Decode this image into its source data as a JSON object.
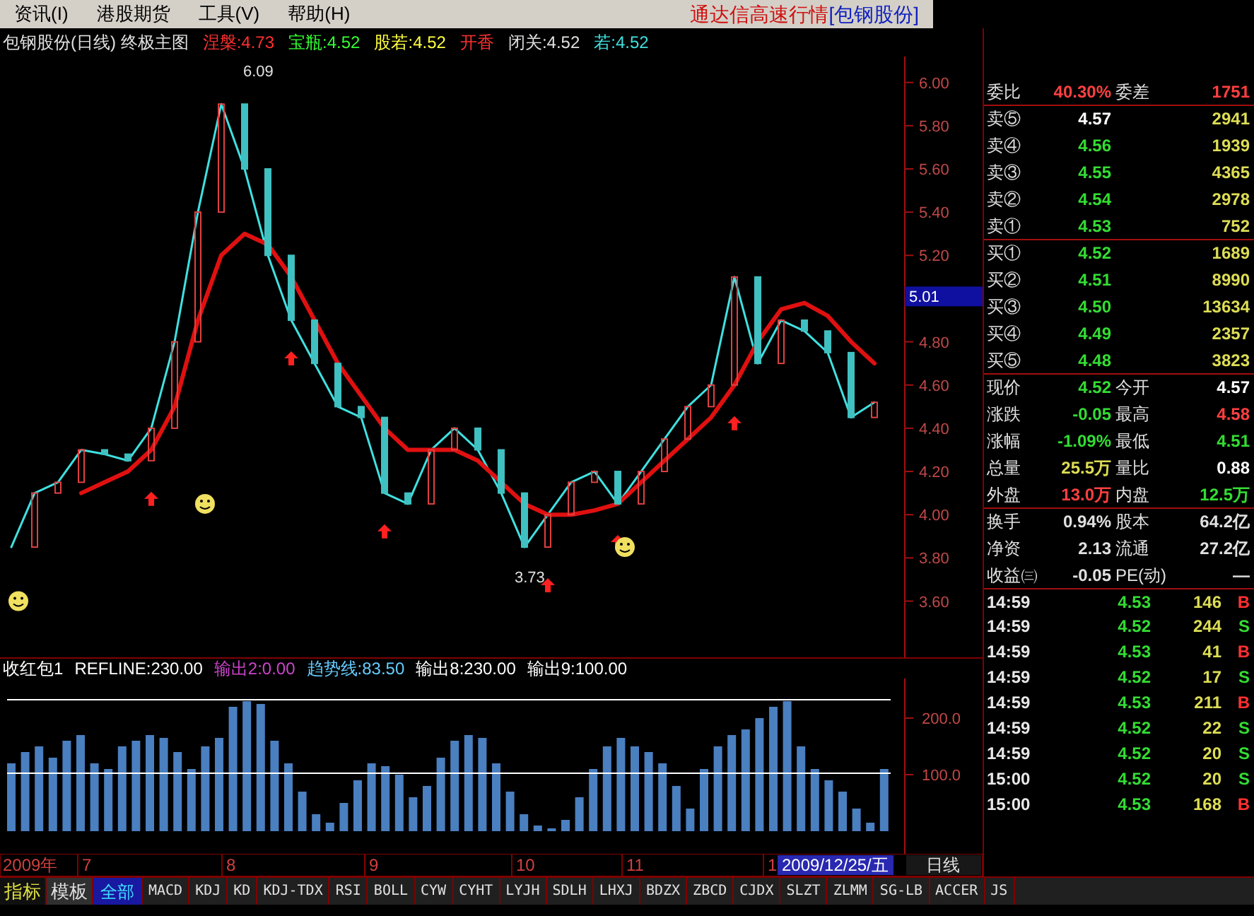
{
  "menu": {
    "items": [
      "资讯(I)",
      "港股期货",
      "工具(V)",
      "帮助(H)"
    ],
    "app_title": "通达信高速行情",
    "stock_title": "[包钢股份]"
  },
  "price_chart": {
    "title": "包钢股份(日线) 终极主图",
    "indicators": [
      {
        "text": "涅槃:4.73",
        "color": "#ff3030"
      },
      {
        "text": "宝瓶:4.52",
        "color": "#33ff33"
      },
      {
        "text": "股若:4.52",
        "color": "#ffff40"
      },
      {
        "text": "开香",
        "color": "#ff3030"
      },
      {
        "text": "闭关:4.52",
        "color": "#e0e0e0"
      },
      {
        "text": "若:4.52",
        "color": "#40e0e0"
      }
    ],
    "cursor_price": "5.01",
    "chart_data": {
      "type": "line",
      "ylim": [
        3.34,
        6.12
      ],
      "yticks": [
        {
          "value": 3.6,
          "label": "3.60"
        },
        {
          "value": 3.8,
          "label": "3.80"
        },
        {
          "value": 4.0,
          "label": "4.00"
        },
        {
          "value": 4.2,
          "label": "4.20"
        },
        {
          "value": 4.4,
          "label": "4.40"
        },
        {
          "value": 4.6,
          "label": "4.60"
        },
        {
          "value": 4.8,
          "label": "4.80"
        },
        {
          "value": 5.2,
          "label": "5.20"
        },
        {
          "value": 5.4,
          "label": "5.40"
        },
        {
          "value": 5.6,
          "label": "5.60"
        },
        {
          "value": 5.8,
          "label": "5.80"
        },
        {
          "value": 6.0,
          "label": "6.00"
        }
      ],
      "series": [
        {
          "color": "#40e0e0",
          "values": [
            3.85,
            4.1,
            4.15,
            4.3,
            4.28,
            4.25,
            4.4,
            4.8,
            5.4,
            5.9,
            5.6,
            5.2,
            4.9,
            4.7,
            4.5,
            4.45,
            4.1,
            4.05,
            4.3,
            4.4,
            4.3,
            4.1,
            3.85,
            4.0,
            4.15,
            4.2,
            4.05,
            4.2,
            4.35,
            4.5,
            4.6,
            5.1,
            4.7,
            4.9,
            4.85,
            4.75,
            4.45,
            4.52
          ]
        },
        {
          "color": "#e01010",
          "values": [
            null,
            null,
            null,
            4.1,
            4.15,
            4.2,
            4.3,
            4.5,
            4.9,
            5.2,
            5.3,
            5.25,
            5.1,
            4.9,
            4.7,
            4.55,
            4.4,
            4.3,
            4.3,
            4.3,
            4.25,
            4.15,
            4.05,
            4.0,
            4.0,
            4.02,
            4.05,
            4.15,
            4.25,
            4.35,
            4.45,
            4.6,
            4.8,
            4.95,
            4.98,
            4.92,
            4.8,
            4.7
          ]
        }
      ],
      "annotations": [
        {
          "text": "6.09"
        },
        {
          "text": "3.73"
        }
      ]
    }
  },
  "indicator_chart": {
    "header": [
      {
        "text": "收红包1",
        "color": "#ffffff"
      },
      {
        "text": "REFLINE:230.00",
        "color": "#ffffff"
      },
      {
        "text": "输出2:0.00",
        "color": "#cc44cc"
      },
      {
        "text": "趋势线:83.50",
        "color": "#66ccff"
      },
      {
        "text": "输出8:230.00",
        "color": "#ffffff"
      },
      {
        "text": "输出9:100.00",
        "color": "#ffffff"
      }
    ],
    "chart_data": {
      "type": "bar",
      "ylim": [
        -40,
        270
      ],
      "yticks": [
        {
          "value": 100,
          "label": "100.0"
        },
        {
          "value": 200,
          "label": "200.0"
        }
      ],
      "series": [
        {
          "color": "#4a7fc0",
          "values": [
            120,
            140,
            150,
            130,
            160,
            170,
            120,
            110,
            150,
            160,
            170,
            165,
            140,
            110,
            150,
            165,
            220,
            230,
            225,
            160,
            120,
            70,
            30,
            15,
            50,
            90,
            120,
            115,
            100,
            60,
            80,
            130,
            160,
            170,
            165,
            120,
            70,
            30,
            10,
            5,
            20,
            60,
            110,
            150,
            165,
            150,
            140,
            120,
            80,
            40,
            110,
            150,
            170,
            180,
            200,
            220,
            230,
            150,
            110,
            90,
            70,
            40,
            15,
            110
          ]
        }
      ]
    }
  },
  "date_axis": {
    "year": "2009年",
    "months": [
      "7",
      "8",
      "9",
      "10",
      "11",
      "1"
    ],
    "cursor_date": "2009/12/25/五",
    "period": "日线"
  },
  "quote": {
    "ratio": {
      "left": {
        "label": "委比",
        "value": "40.30%",
        "color": "#ff4040"
      },
      "right": {
        "label": "委差",
        "value": "1751",
        "color": "#ff4040"
      }
    },
    "asks": [
      {
        "label": "卖⑤",
        "price": "4.57",
        "volume": "2941",
        "color": "#ffffff"
      },
      {
        "label": "卖④",
        "price": "4.56",
        "volume": "1939",
        "color": "#33dd33"
      },
      {
        "label": "卖③",
        "price": "4.55",
        "volume": "4365",
        "color": "#33dd33"
      },
      {
        "label": "卖②",
        "price": "4.54",
        "volume": "2978",
        "color": "#33dd33"
      },
      {
        "label": "卖①",
        "price": "4.53",
        "volume": "752",
        "color": "#33dd33"
      }
    ],
    "bids": [
      {
        "label": "买①",
        "price": "4.52",
        "volume": "1689",
        "color": "#33dd33"
      },
      {
        "label": "买②",
        "price": "4.51",
        "volume": "8990",
        "color": "#33dd33"
      },
      {
        "label": "买③",
        "price": "4.50",
        "volume": "13634",
        "color": "#33dd33"
      },
      {
        "label": "买④",
        "price": "4.49",
        "volume": "2357",
        "color": "#33dd33"
      },
      {
        "label": "买⑤",
        "price": "4.48",
        "volume": "3823",
        "color": "#33dd33"
      }
    ],
    "stats": [
      {
        "left": {
          "label": "现价",
          "value": "4.52",
          "color": "#33dd33"
        },
        "right": {
          "label": "今开",
          "value": "4.57",
          "color": "#ffffff"
        }
      },
      {
        "left": {
          "label": "涨跌",
          "value": "-0.05",
          "color": "#33dd33"
        },
        "right": {
          "label": "最高",
          "value": "4.58",
          "color": "#ff4040"
        }
      },
      {
        "left": {
          "label": "涨幅",
          "value": "-1.09%",
          "color": "#33dd33"
        },
        "right": {
          "label": "最低",
          "value": "4.51",
          "color": "#33dd33"
        }
      },
      {
        "left": {
          "label": "总量",
          "value": "25.5万",
          "color": "#dddd55"
        },
        "right": {
          "label": "量比",
          "value": "0.88",
          "color": "#ffffff"
        }
      },
      {
        "left": {
          "label": "外盘",
          "value": "13.0万",
          "color": "#ff4040"
        },
        "right": {
          "label": "内盘",
          "value": "12.5万",
          "color": "#33dd33"
        }
      }
    ],
    "finance": [
      {
        "left": {
          "label": "换手",
          "value": "0.94%"
        },
        "right": {
          "label": "股本",
          "value": "64.2亿"
        }
      },
      {
        "left": {
          "label": "净资",
          "value": "2.13"
        },
        "right": {
          "label": "流通",
          "value": "27.2亿"
        }
      },
      {
        "left": {
          "label": "收益㈢",
          "value": "-0.05"
        },
        "right": {
          "label": "PE(动)",
          "value": "—"
        }
      }
    ],
    "ticks": [
      {
        "time": "14:59",
        "price": "4.53",
        "volume": "146",
        "side": "B"
      },
      {
        "time": "14:59",
        "price": "4.52",
        "volume": "244",
        "side": "S"
      },
      {
        "time": "14:59",
        "price": "4.53",
        "volume": "41",
        "side": "B"
      },
      {
        "time": "14:59",
        "price": "4.52",
        "volume": "17",
        "side": "S"
      },
      {
        "time": "14:59",
        "price": "4.53",
        "volume": "211",
        "side": "B"
      },
      {
        "time": "14:59",
        "price": "4.52",
        "volume": "22",
        "side": "S"
      },
      {
        "time": "14:59",
        "price": "4.52",
        "volume": "20",
        "side": "S"
      },
      {
        "time": "15:00",
        "price": "4.52",
        "volume": "20",
        "side": "S"
      },
      {
        "time": "15:00",
        "price": "4.53",
        "volume": "168",
        "side": "B"
      }
    ]
  },
  "mode_tabs": [
    {
      "label": "指标",
      "selected": true
    },
    {
      "label": "模板",
      "selected": false
    }
  ],
  "tabs": [
    {
      "label": "全部",
      "selected": true
    },
    {
      "label": "MACD",
      "selected": false
    },
    {
      "label": "KDJ",
      "selected": false
    },
    {
      "label": "KD",
      "selected": false
    },
    {
      "label": "KDJ-TDX",
      "selected": false
    },
    {
      "label": "RSI",
      "selected": false
    },
    {
      "label": "BOLL",
      "selected": false
    },
    {
      "label": "CYW",
      "selected": false
    },
    {
      "label": "CYHT",
      "selected": false
    },
    {
      "label": "LYJH",
      "selected": false
    },
    {
      "label": "SDLH",
      "selected": false
    },
    {
      "label": "LHXJ",
      "selected": false
    },
    {
      "label": "BDZX",
      "selected": false
    },
    {
      "label": "ZBCD",
      "selected": false
    },
    {
      "label": "CJDX",
      "selected": false
    },
    {
      "label": "SLZT",
      "selected": false
    },
    {
      "label": "ZLMM",
      "selected": false
    },
    {
      "label": "SG-LB",
      "selected": false
    },
    {
      "label": "ACCER",
      "selected": false
    },
    {
      "label": "JS",
      "selected": false
    }
  ]
}
